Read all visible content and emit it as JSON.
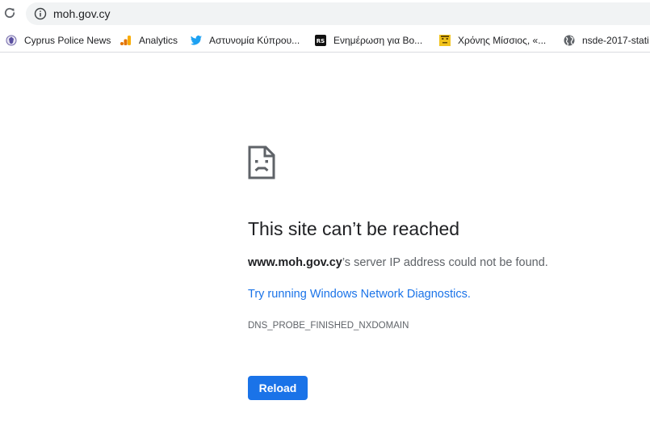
{
  "omnibox": {
    "url": "moh.gov.cy",
    "security_icon": "info-icon"
  },
  "toolbar": {
    "reload_icon": "reload-icon"
  },
  "bookmarks": [
    {
      "label": "Cyprus Police News",
      "icon": "police-emblem-icon"
    },
    {
      "label": "Analytics",
      "icon": "analytics-icon",
      "color": "#f9ab00"
    },
    {
      "label": "Αστυνομία Κύπρου...",
      "icon": "twitter-icon",
      "color": "#1da1f2"
    },
    {
      "label": "Ενημέρωση για Βο...",
      "icon": "rs-icon"
    },
    {
      "label": "Χρόνης Μίσσιος, «...",
      "icon": "face-icon",
      "color": "#f2c31b"
    },
    {
      "label": "nsde-2017-stati",
      "icon": "globe-icon"
    }
  ],
  "error": {
    "icon": "sad-page-icon",
    "title": "This site can’t be reached",
    "host": "www.moh.gov.cy",
    "message": "’s server IP address could not be found.",
    "diagnostics_link": "Try running Windows Network Diagnostics",
    "diagnostics_suffix": ".",
    "error_code": "DNS_PROBE_FINISHED_NXDOMAIN",
    "reload_label": "Reload"
  },
  "colors": {
    "accent": "#1a73e8",
    "text_primary": "#202124",
    "text_secondary": "#5f6368",
    "omnibox_bg": "#f1f3f4"
  }
}
